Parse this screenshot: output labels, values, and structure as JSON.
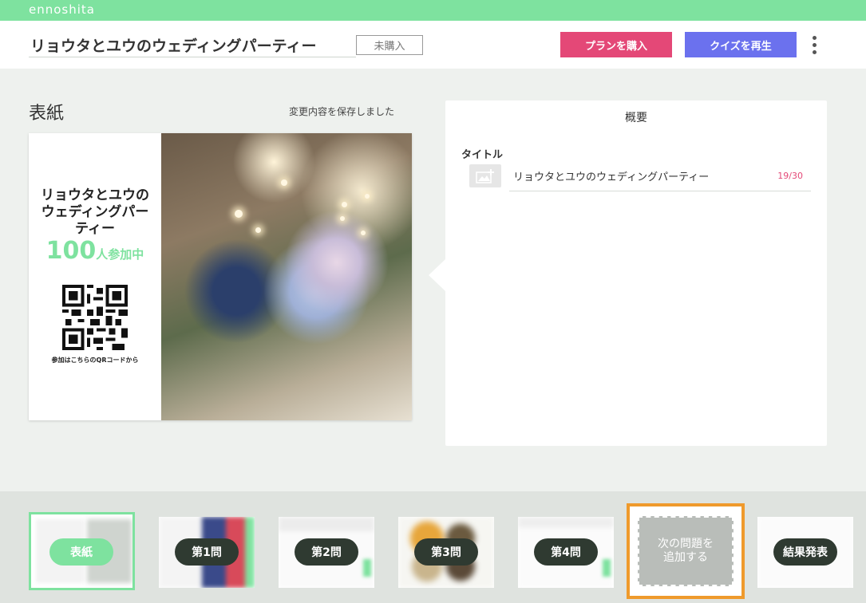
{
  "app": {
    "brand": "ennoshita"
  },
  "header": {
    "quiz_title": "リョウタとユウのウェディングパーティー",
    "purchase_status": "未購入",
    "buy_plan_label": "プランを購入",
    "play_quiz_label": "クイズを再生",
    "more_icon": "kebab-menu-icon"
  },
  "editor": {
    "section_title": "表紙",
    "save_status": "変更内容を保存しました",
    "cover": {
      "title": "リョウタとユウのウェディングパーティー",
      "participant_count": "100",
      "participant_suffix": "人参加中",
      "qr_caption": "参加はこちらのQRコードから"
    }
  },
  "summary": {
    "heading": "概要",
    "title_label": "タイトル",
    "title_value": "リョウタとユウのウェディングパーティー",
    "title_counter": "19/30"
  },
  "slides": [
    {
      "label": "表紙"
    },
    {
      "label": "第1問"
    },
    {
      "label": "第2問"
    },
    {
      "label": "第3問"
    },
    {
      "label": "第4問"
    },
    {
      "label": "次の問題を追加する",
      "line1": "次の問題を",
      "line2": "追加する"
    },
    {
      "label": "結果発表"
    }
  ],
  "colors": {
    "brand_green": "#7ee29f",
    "buy_pink": "#e44877",
    "play_blue": "#6b71ee",
    "add_highlight": "#ef9a2c",
    "pill_dark": "#2f3a31"
  }
}
